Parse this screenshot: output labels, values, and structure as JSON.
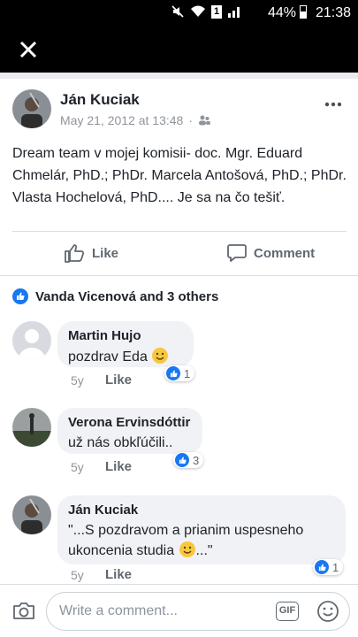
{
  "status_bar": {
    "battery": "44%",
    "time": "21:38",
    "sim_label": "1"
  },
  "header": {
    "close_label": "✕"
  },
  "post": {
    "author": "Ján Kuciak",
    "date": "May 21, 2012 at 13:48",
    "separator": "·",
    "privacy_icon": "friends-icon",
    "more_label": "•••",
    "text": "Dream team v mojej komisii- doc. Mgr. Eduard Chmelár, PhD.; PhDr. Marcela Antošová, PhD.; PhDr. Vlasta Hochelová, PhD.... Je sa na čo tešiť."
  },
  "actions": {
    "like_label": "Like",
    "comment_label": "Comment"
  },
  "reactions": {
    "summary": "Vanda Vicenová and 3 others"
  },
  "comments": [
    {
      "author": "Martin Hujo",
      "text": "pozdrav Eda",
      "has_emoji": true,
      "time": "5y",
      "like_label": "Like",
      "reaction_count": "1"
    },
    {
      "author": "Verona Ervinsdóttir",
      "text": "už nás obkľúčili..",
      "has_emoji": false,
      "time": "5y",
      "like_label": "Like",
      "reaction_count": "3"
    },
    {
      "author": "Ján Kuciak",
      "text_line1": "\"...S pozdravom a prianim uspesneho",
      "text_line2": "ukoncenia studia",
      "text_end": "...\"",
      "has_emoji": true,
      "time": "5y",
      "like_label": "Like",
      "reaction_count": "1"
    }
  ],
  "composer": {
    "placeholder": "Write a comment...",
    "gif_label": "GIF"
  },
  "colors": {
    "accent": "#1877f2",
    "bubble": "#f0f2f5",
    "text": "#1d2129",
    "muted": "#90949c",
    "bar": "#000000"
  }
}
